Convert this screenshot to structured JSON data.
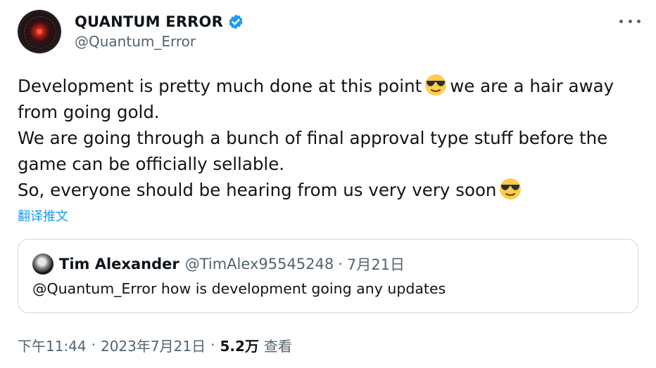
{
  "author": {
    "display_name": "QUANTUM ERROR",
    "handle": "@Quantum_Error",
    "verified": true
  },
  "tweet": {
    "line1_a": "Development is pretty much done at this point",
    "line1_b": "we are a hair away",
    "line2": "from going gold.",
    "line3": "We are going through a bunch of final approval type stuff before the",
    "line4": "game can be officially sellable.",
    "line5": "So, everyone should be hearing from us very very soon",
    "emoji": "smiling-face-with-sunglasses"
  },
  "translate_label": "翻译推文",
  "quoted": {
    "display_name": "Tim Alexander",
    "handle": "@TimAlex95545248",
    "separator": "·",
    "date": "7月21日",
    "text": "@Quantum_Error how is development going any updates"
  },
  "meta": {
    "time": "下午11:44",
    "separator": "·",
    "date": "2023年7月21日",
    "views_count": "5.2万",
    "views_label": "查看"
  },
  "colors": {
    "accent": "#1d9bf0",
    "secondary_text": "#536471",
    "border": "#cfd9de",
    "verified_badge": "#1d9bf0"
  },
  "icons": {
    "more": "more-horizontal-icon",
    "verified": "verified-badge-icon"
  }
}
